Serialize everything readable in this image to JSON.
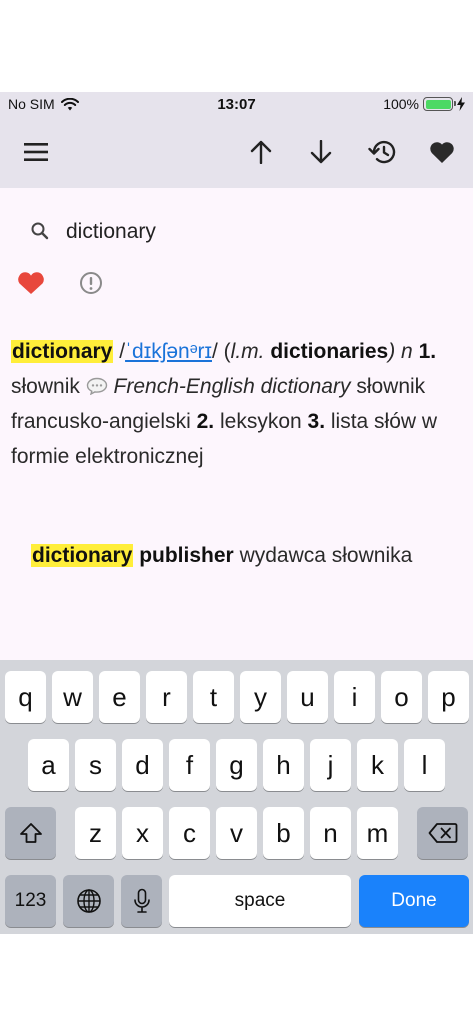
{
  "status_bar": {
    "carrier": "No SIM",
    "time": "13:07",
    "battery": "100%"
  },
  "search": {
    "value": "dictionary"
  },
  "entry": {
    "headword": "dictionary",
    "pron_open": "/",
    "pronunciation": "ˈdɪkʃənᵊrɪ",
    "pron_close": "/ (",
    "plural_label": "l.m.",
    "plural_form": "dictionaries",
    "pos_text": ") n",
    "sense1_num": "1.",
    "sense1_text": "słownik",
    "example_en": "French-English dictionary",
    "example_pl": "słownik francusko-angielski",
    "sense2_num": "2.",
    "sense2_text": "leksykon",
    "sense3_num": "3.",
    "sense3_text": "lista słów w formie elektronicznej"
  },
  "phrase": {
    "headword": "dictionary",
    "term": "publisher",
    "translation": "wydawca słownika"
  },
  "keyboard": {
    "row1": [
      "q",
      "w",
      "e",
      "r",
      "t",
      "y",
      "u",
      "i",
      "o",
      "p"
    ],
    "row2": [
      "a",
      "s",
      "d",
      "f",
      "g",
      "h",
      "j",
      "k",
      "l"
    ],
    "row3": [
      "z",
      "x",
      "c",
      "v",
      "b",
      "n",
      "m"
    ],
    "numbers_label": "123",
    "space_label": "space",
    "done_label": "Done"
  },
  "colors": {
    "accent": "#1a82fb",
    "highlight": "#ffee3a",
    "favorite": "#e8473c",
    "bar_background": "#e6e3ec",
    "content_background": "#fdf6fd"
  }
}
